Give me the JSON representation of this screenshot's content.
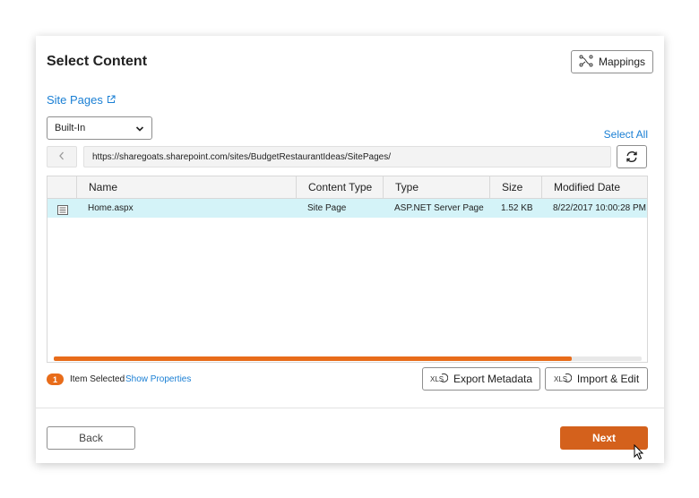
{
  "dialog": {
    "title": "Select Content",
    "mappings_label": "Mappings"
  },
  "site": {
    "link_label": "Site Pages",
    "dropdown_value": "Built-In",
    "select_all_label": "Select All",
    "url": "https://sharegoats.sharepoint.com/sites/BudgetRestaurantIdeas/SitePages/"
  },
  "table": {
    "columns": [
      "Name",
      "Content Type",
      "Type",
      "Size",
      "Modified Date"
    ],
    "rows": [
      {
        "name": "Home.aspx",
        "content_type": "Site Page",
        "type": "ASP.NET Server Page",
        "size": "1.52 KB",
        "modified": "8/22/2017 10:00:28 PM",
        "selected": true
      }
    ],
    "horizontal_scroll_position": 0.88
  },
  "footer": {
    "selected_count": "1",
    "selected_text": "Item Selected",
    "show_properties_label": "Show Properties",
    "export_label": "Export Metadata",
    "import_label": "Import & Edit",
    "back_label": "Back",
    "next_label": "Next"
  },
  "colors": {
    "accent_orange": "#e86c1a",
    "next_button": "#d4611c",
    "link_blue": "#1a7fd4",
    "selected_row": "#d4f3f8"
  },
  "icons": {
    "mappings": "mappings-icon",
    "external_link": "external-link-icon",
    "dropdown": "chevron-down-icon",
    "back": "chevron-left-icon",
    "refresh": "refresh-icon",
    "page": "page-icon",
    "xls": "xls-icon",
    "cursor": "mouse-cursor-icon"
  }
}
